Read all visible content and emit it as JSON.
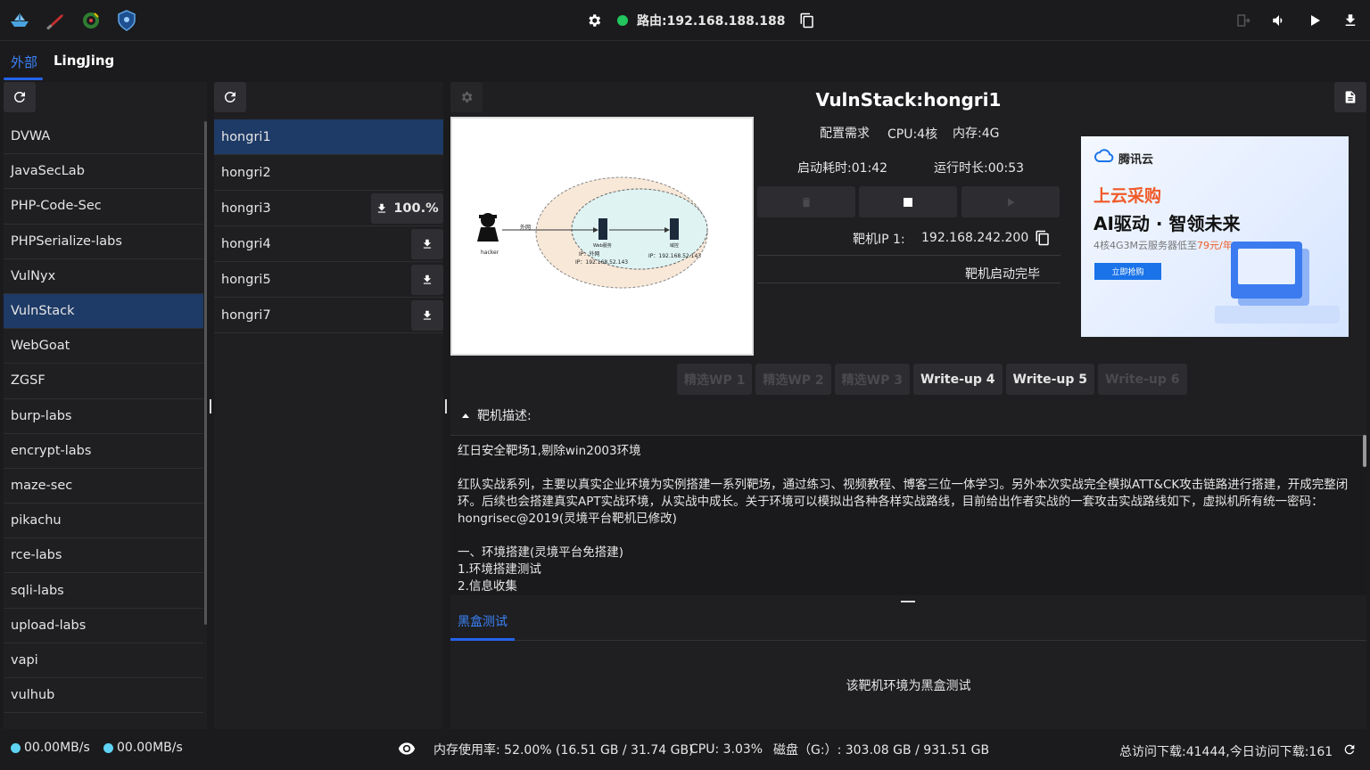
{
  "topbar": {
    "route_label": "路由:192.168.188.188",
    "app_icons": [
      "ship-icon",
      "knife-icon",
      "target-icon",
      "shield-icon"
    ],
    "right_icons": [
      "exit-icon",
      "volume-icon",
      "play-icon",
      "download-icon"
    ]
  },
  "tabs": [
    {
      "label": "外部",
      "active": true
    },
    {
      "label": "LingJing",
      "active": false
    }
  ],
  "categories": [
    "DVWA",
    "JavaSecLab",
    "PHP-Code-Sec",
    "PHPSerialize-labs",
    "VulNyx",
    "VulnStack",
    "WebGoat",
    "ZGSF",
    "burp-labs",
    "encrypt-labs",
    "maze-sec",
    "pikachu",
    "rce-labs",
    "sqli-labs",
    "upload-labs",
    "vapi",
    "vulhub"
  ],
  "selected_category": "VulnStack",
  "machines": [
    {
      "name": "hongri1",
      "status": "selected"
    },
    {
      "name": "hongri2",
      "status": "none"
    },
    {
      "name": "hongri3",
      "status": "progress",
      "progress_label": "100.%"
    },
    {
      "name": "hongri4",
      "status": "download"
    },
    {
      "name": "hongri5",
      "status": "download"
    },
    {
      "name": "hongri7",
      "status": "download"
    }
  ],
  "detail": {
    "title": "VulnStack:hongri1",
    "config_label": "配置需求",
    "cpu": "CPU:4核",
    "memory": "内存:4G",
    "startup_time": "启动耗时:01:42",
    "run_time": "运行时长:00:53",
    "ip_label": "靶机IP 1:",
    "ip_value": "192.168.242.200",
    "status_text": "靶机启动完毕",
    "diagram": {
      "hacker": "hacker",
      "outer_net": "外网",
      "web_server": "Web服务",
      "web_ip_outer": "IP：外网",
      "web_ip_inner": "IP：192.168.52.143",
      "domain_ctrl": "域控",
      "dc_ip": "IP：192.168.52.143"
    },
    "ad": {
      "brand": "腾讯云",
      "headline": "上云采购",
      "slogan": "AI驱动 · 智领未来",
      "offer_prefix": "4核4G3M云服务器低至",
      "offer_price": "79元/年",
      "button": "立即抢购"
    },
    "writeups": [
      {
        "label": "精选WP 1",
        "enabled": false
      },
      {
        "label": "精选WP 2",
        "enabled": false
      },
      {
        "label": "精选WP 3",
        "enabled": false
      },
      {
        "label": "Write-up 4",
        "enabled": true
      },
      {
        "label": "Write-up 5",
        "enabled": true
      },
      {
        "label": "Write-up 6",
        "enabled": false
      }
    ],
    "desc_title": "靶机描述:",
    "desc_lines": [
      "红日安全靶场1,剔除win2003环境",
      "",
      "红队实战系列，主要以真实企业环境为实例搭建一系列靶场，通过练习、视频教程、博客三位一体学习。另外本次实战完全模拟ATT&CK攻击链路进行搭建，开成完整闭环。后续也会搭建真实APT实战环境，从实战中成长。关于环境可以模拟出各种各样实战路线，目前给出作者实战的一套攻击实战路线如下，虚拟机所有统一密码：hongrisec@2019(灵境平台靶机已修改)",
      "",
      "一、环境搭建(灵境平台免搭建)",
      "1.环境搭建测试",
      "2.信息收集"
    ],
    "blackbox_tab": "黑盒测试",
    "blackbox_text": "该靶机环境为黑盒测试"
  },
  "bottombar": {
    "upload_speed": "00.00MB/s",
    "download_speed": "00.00MB/s",
    "memory_usage": "内存使用率: 52.00% (16.51 GB / 31.74 GB)",
    "cpu_usage": "CPU: 3.03%",
    "disk": "磁盘（G:）: 303.08 GB / 931.51 GB",
    "visits": "总访问下载:41444,今日访问下载:161"
  }
}
